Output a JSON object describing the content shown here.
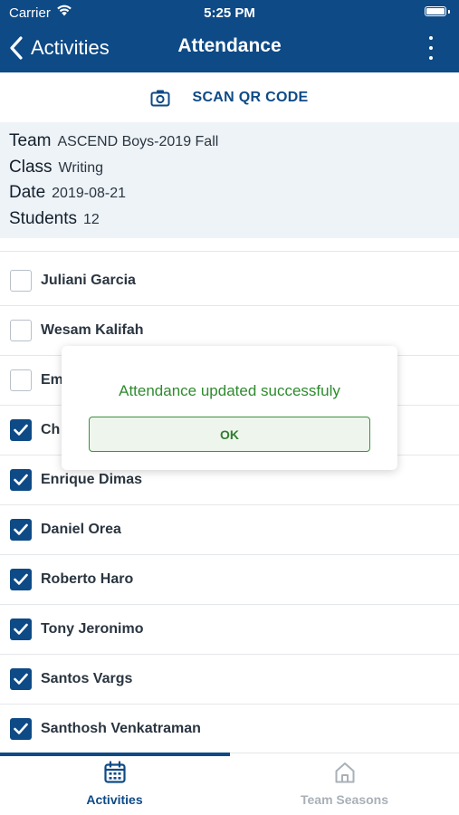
{
  "status_bar": {
    "carrier": "Carrier",
    "time": "5:25 PM"
  },
  "nav": {
    "back_label": "Activities",
    "title": "Attendance"
  },
  "scan": {
    "label": "SCAN QR CODE"
  },
  "info": {
    "team_key": "Team",
    "team_value": "ASCEND Boys-2019 Fall",
    "class_key": "Class",
    "class_value": "Writing",
    "date_key": "Date",
    "date_value": "2019-08-21",
    "students_key": "Students",
    "students_value": "12"
  },
  "students": [
    {
      "name": "",
      "checked": false
    },
    {
      "name": "Juliani Garcia",
      "checked": false
    },
    {
      "name": "Wesam Kalifah",
      "checked": false
    },
    {
      "name": "Em",
      "checked": false
    },
    {
      "name": "Ch",
      "checked": true
    },
    {
      "name": "Enrique Dimas",
      "checked": true
    },
    {
      "name": "Daniel Orea",
      "checked": true
    },
    {
      "name": "Roberto Haro",
      "checked": true
    },
    {
      "name": "Tony Jeronimo",
      "checked": true
    },
    {
      "name": "Santos Vargs",
      "checked": true
    },
    {
      "name": "Santhosh Venkatraman",
      "checked": true
    }
  ],
  "dialog": {
    "message": "Attendance updated successfuly",
    "ok_label": "OK"
  },
  "tabs": [
    {
      "label": "Activities",
      "icon": "calendar-icon",
      "active": true
    },
    {
      "label": "Team Seasons",
      "icon": "home-icon",
      "active": false
    }
  ],
  "colors": {
    "primary": "#0e4a86",
    "success": "#2e8b2e",
    "info_bg": "#eef3f8"
  }
}
